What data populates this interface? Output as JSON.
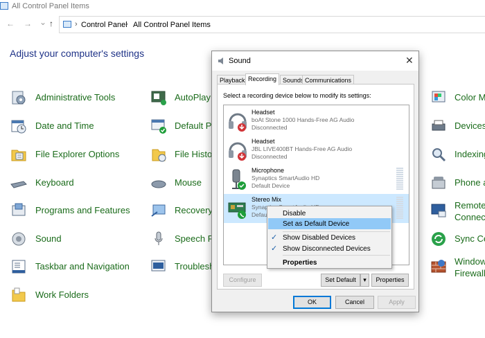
{
  "window": {
    "title": "All Control Panel Items"
  },
  "address": {
    "crumbs": [
      "Control Panel",
      "All Control Panel Items"
    ]
  },
  "nav": {
    "back": "←",
    "forward": "→",
    "dropdown": "⌄",
    "up": "↑"
  },
  "heading": "Adjust your computer's settings",
  "items": {
    "col1": [
      "Administrative Tools",
      "Date and Time",
      "File Explorer Options",
      "Keyboard",
      "Programs and Features",
      "Sound",
      "Taskbar and Navigation",
      "Work Folders"
    ],
    "col2": [
      "AutoPlay",
      "Default Pr",
      "File Histo",
      "Mouse",
      "Recovery",
      "Speech Re",
      "Troublesh"
    ],
    "col3": [
      "Color M",
      "Devices",
      "Indexing",
      "Phone a",
      "Remote",
      "Sync Ce",
      "Window"
    ],
    "col3_line2": {
      "remote": "Connect",
      "windows": "Firewall"
    }
  },
  "dialog": {
    "title": "Sound",
    "close": "✕",
    "tabs": [
      "Playback",
      "Recording",
      "Sounds",
      "Communications"
    ],
    "active_tab": "Recording",
    "instruction": "Select a recording device below to modify its settings:",
    "devices": [
      {
        "name": "Headset",
        "desc": "boAt Stone 1000 Hands-Free AG Audio",
        "status": "Disconnected"
      },
      {
        "name": "Headset",
        "desc": "JBL LIVE400BT Hands-Free AG Audio",
        "status": "Disconnected"
      },
      {
        "name": "Microphone",
        "desc": "Synaptics SmartAudio HD",
        "status": "Default Device"
      },
      {
        "name": "Stereo Mix",
        "desc": "Synaptics SmartAudio HD",
        "status": "Default Device"
      }
    ],
    "buttons": {
      "configure": "Configure",
      "set_default": "Set Default",
      "dropdown": "▾",
      "properties": "Properties",
      "ok": "OK",
      "cancel": "Cancel",
      "apply": "Apply"
    }
  },
  "context_menu": {
    "disable": "Disable",
    "set_default": "Set as Default Device",
    "show_disabled": "Show Disabled Devices",
    "show_disconnected": "Show Disconnected Devices",
    "properties": "Properties",
    "check": "✓"
  },
  "colors": {
    "link_green": "#1a6b1a",
    "heading_blue": "#1e3287",
    "selection": "#cce8ff",
    "menu_highlight": "#91c9f7",
    "status_green": "#1e9e3a",
    "status_red": "#d13438"
  },
  "icons": {
    "col1": [
      "admin-tools-icon",
      "date-time-icon",
      "folder-options-icon",
      "keyboard-icon",
      "programs-icon",
      "sound-icon",
      "taskbar-icon",
      "work-folders-icon"
    ],
    "col2": [
      "autoplay-icon",
      "default-programs-icon",
      "file-history-icon",
      "mouse-icon",
      "recovery-icon",
      "speech-icon",
      "troubleshoot-icon"
    ],
    "col3": [
      "color-management-icon",
      "devices-printers-icon",
      "indexing-icon",
      "phone-modem-icon",
      "remote-app-icon",
      "sync-center-icon",
      "firewall-icon"
    ]
  }
}
